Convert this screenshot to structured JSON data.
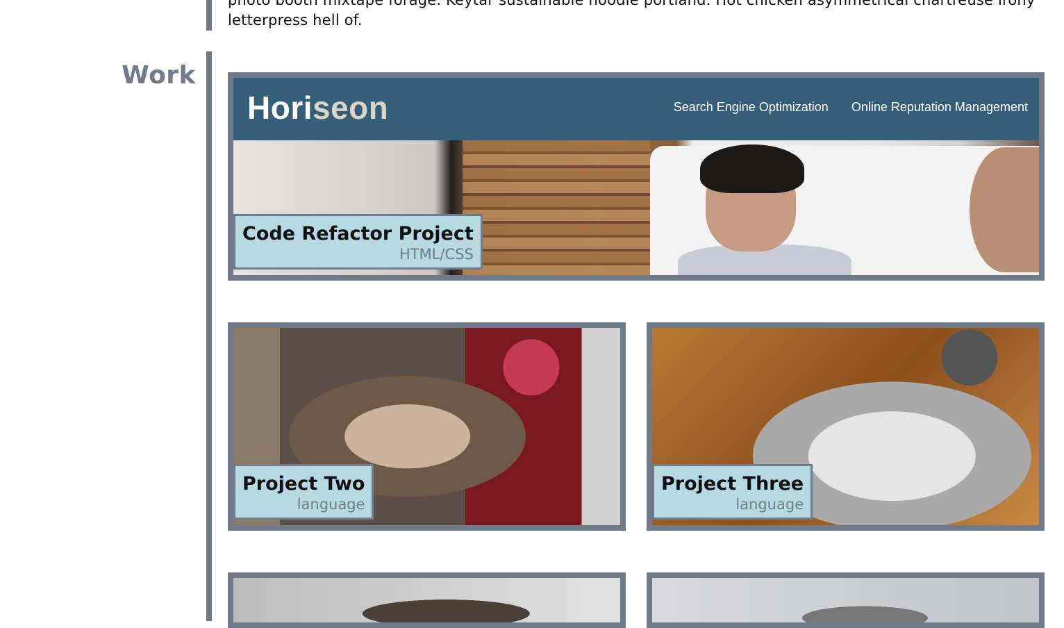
{
  "about": {
    "text": "photo booth mixtape forage. Keytar sustainable hoodie portland. Hot chicken asymmetrical chartreuse irony letterpress hell of."
  },
  "work": {
    "title": "Work",
    "featured": {
      "title": "Code Refactor Project",
      "language": "HTML/CSS",
      "preview": {
        "logo_main": "Hori",
        "logo_accent": "seon",
        "nav": [
          "Search Engine Optimization",
          "Online Reputation Management"
        ]
      }
    },
    "projects": [
      {
        "title": "Project Two",
        "language": "language"
      },
      {
        "title": "Project Three",
        "language": "language"
      }
    ]
  }
}
